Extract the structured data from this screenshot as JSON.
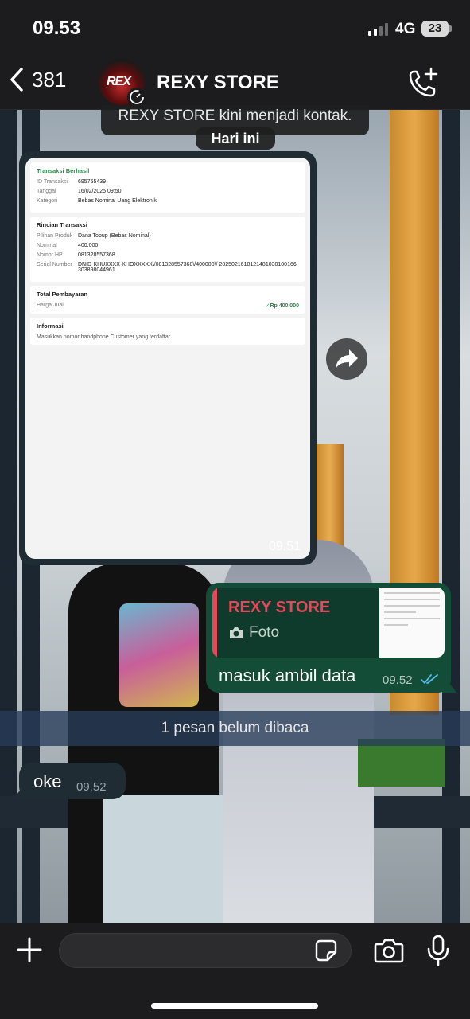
{
  "status": {
    "time": "09.53",
    "network": "4G",
    "battery": "23"
  },
  "header": {
    "back_count": "381",
    "contact_name": "REXY STORE",
    "avatar_text": "REX"
  },
  "system": {
    "notice": "REXY STORE kini menjadi kontak.",
    "date": "Hari ini"
  },
  "receipt": {
    "success_title": "Transaksi Berhasil",
    "summary": [
      {
        "k": "ID Transaksi",
        "v": "695755439"
      },
      {
        "k": "Tanggal",
        "v": "16/02/2025 09:50"
      },
      {
        "k": "Kategori",
        "v": "Bebas Nominal Uang Elektronik"
      }
    ],
    "detail_title": "Rincian Transaksi",
    "detail": [
      {
        "k": "Pilihan Produk",
        "v": "Dana Topup (Bebas Nominal)"
      },
      {
        "k": "Nominal",
        "v": "400.000"
      },
      {
        "k": "Nomor HP",
        "v": "081328557368"
      },
      {
        "k": "Serial Number",
        "v": "DNID-KHUXXXX-KHOXXXXX\\/081328557368\\/400000\\/ 20250216101214810301001663038980449​61"
      }
    ],
    "total_title": "Total Pembayaran",
    "total_label": "Harga Jual",
    "total_value": "✓Rp 400.000",
    "info_title": "Informasi",
    "info_text": "Masukkan nomor handphone Customer yang terdaftar."
  },
  "messages": {
    "image_time": "09.51",
    "reply_quote_name": "REXY STORE",
    "reply_quote_type": "Foto",
    "reply_text": "masuk ambil data",
    "reply_time": "09.52",
    "unread_divider": "1 pesan belum dibaca",
    "incoming_text": "oke",
    "incoming_time": "09.52"
  },
  "input": {
    "placeholder": ""
  },
  "colors": {
    "outgoing_bubble": "#134d37",
    "incoming_bubble": "#1f2c33",
    "quote_accent": "#e8475a",
    "read_ticks": "#53bdeb"
  }
}
